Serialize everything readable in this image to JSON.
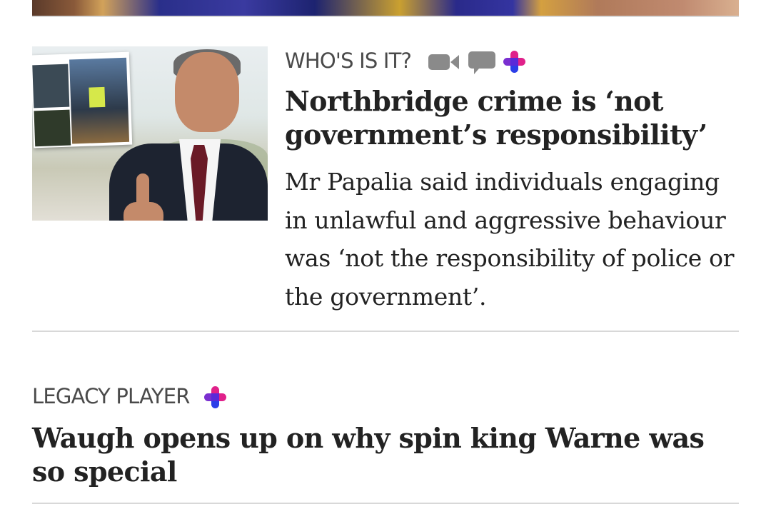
{
  "top_story": {
    "image_alt": "Partial hero image from previous story"
  },
  "story1": {
    "kicker": "WHO'S IS IT?",
    "headline": "Northbridge crime is ‘not government’s responsibility’",
    "standfirst": "Mr Papalia said individuals engaging in unlawful and aggressive behaviour was ‘not the responsibility of police or the government’.",
    "icons": [
      "video-camera-icon",
      "comment-icon",
      "premium-plus-icon"
    ]
  },
  "story2": {
    "kicker": "LEGACY PLAYER",
    "headline": "Waugh opens up on why spin king Warne was so special",
    "icons": [
      "premium-plus-icon"
    ]
  },
  "colors": {
    "kicker": "#4a4a4a",
    "headline": "#222222",
    "rule": "#d8d8d8",
    "icon_grey": "#8a8a8a",
    "plus_magenta": "#e0218a",
    "plus_blue": "#2c3ee8",
    "plus_purple": "#7a2fd0"
  }
}
